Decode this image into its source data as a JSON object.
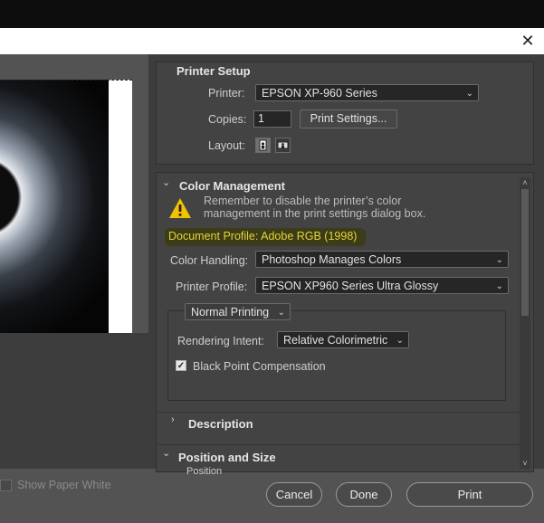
{
  "window": {
    "close_glyph": "✕"
  },
  "preview": {
    "show_paper_white_label": "Show Paper White"
  },
  "printer_setup": {
    "title": "Printer Setup",
    "printer_label": "Printer:",
    "printer_value": "EPSON XP-960 Series",
    "copies_label": "Copies:",
    "copies_value": "1",
    "print_settings_button": "Print Settings...",
    "layout_label": "Layout:"
  },
  "color_management": {
    "title": "Color Management",
    "warning_line1": "Remember to disable the printer’s color",
    "warning_line2": "management in the print settings dialog box.",
    "document_profile": "Document Profile: Adobe RGB (1998)",
    "color_handling_label": "Color Handling:",
    "color_handling_value": "Photoshop Manages Colors",
    "printer_profile_label": "Printer Profile:",
    "printer_profile_value": "EPSON XP960 Series Ultra Glossy",
    "printing_mode_value": "Normal Printing",
    "rendering_intent_label": "Rendering Intent:",
    "rendering_intent_value": "Relative Colorimetric",
    "black_point_label": "Black Point Compensation",
    "black_point_checked": true
  },
  "description": {
    "title": "Description"
  },
  "position_size": {
    "title": "Position and Size",
    "position_label": "Position"
  },
  "buttons": {
    "cancel": "Cancel",
    "done": "Done",
    "print": "Print"
  },
  "colors": {
    "highlight": "#e3d43a",
    "warning": "#f2c200"
  },
  "icons": {
    "warning": "warning-icon",
    "close": "close-icon",
    "portrait": "portrait-layout-icon",
    "landscape": "landscape-layout-icon"
  }
}
